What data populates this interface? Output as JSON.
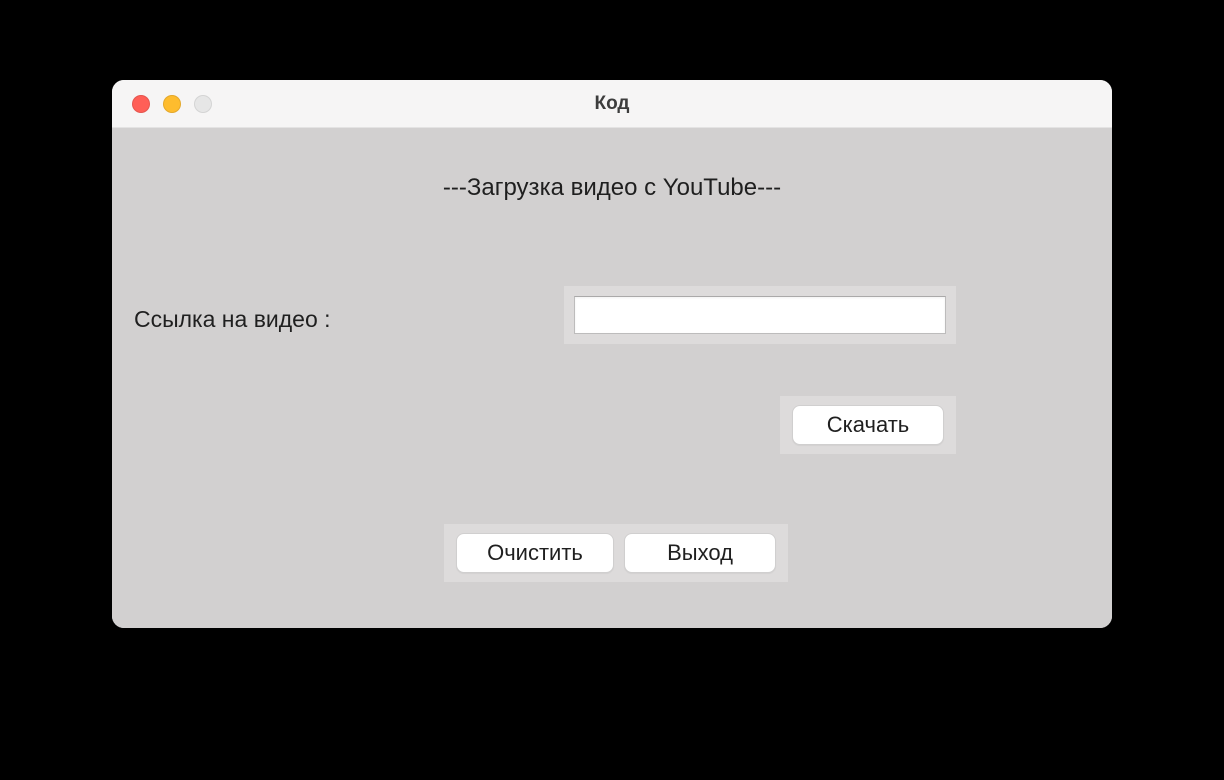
{
  "window": {
    "title": "Код"
  },
  "heading": "---Загрузка видео с YouTube---",
  "form": {
    "link_label": "Ссылка на видео :",
    "link_value": ""
  },
  "buttons": {
    "download": "Скачать",
    "clear": "Очистить",
    "exit": "Выход"
  }
}
